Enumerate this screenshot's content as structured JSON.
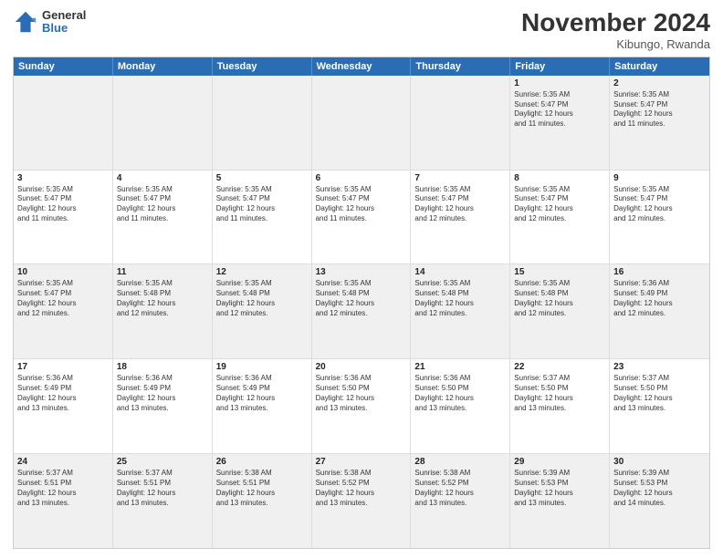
{
  "logo": {
    "general": "General",
    "blue": "Blue"
  },
  "header": {
    "month": "November 2024",
    "location": "Kibungo, Rwanda"
  },
  "weekdays": [
    "Sunday",
    "Monday",
    "Tuesday",
    "Wednesday",
    "Thursday",
    "Friday",
    "Saturday"
  ],
  "rows": [
    {
      "cells": [
        {
          "empty": true
        },
        {
          "empty": true
        },
        {
          "empty": true
        },
        {
          "empty": true
        },
        {
          "empty": true
        },
        {
          "day": 1,
          "lines": [
            "Sunrise: 5:35 AM",
            "Sunset: 5:47 PM",
            "Daylight: 12 hours",
            "and 11 minutes."
          ]
        },
        {
          "day": 2,
          "lines": [
            "Sunrise: 5:35 AM",
            "Sunset: 5:47 PM",
            "Daylight: 12 hours",
            "and 11 minutes."
          ]
        }
      ]
    },
    {
      "cells": [
        {
          "day": 3,
          "lines": [
            "Sunrise: 5:35 AM",
            "Sunset: 5:47 PM",
            "Daylight: 12 hours",
            "and 11 minutes."
          ]
        },
        {
          "day": 4,
          "lines": [
            "Sunrise: 5:35 AM",
            "Sunset: 5:47 PM",
            "Daylight: 12 hours",
            "and 11 minutes."
          ]
        },
        {
          "day": 5,
          "lines": [
            "Sunrise: 5:35 AM",
            "Sunset: 5:47 PM",
            "Daylight: 12 hours",
            "and 11 minutes."
          ]
        },
        {
          "day": 6,
          "lines": [
            "Sunrise: 5:35 AM",
            "Sunset: 5:47 PM",
            "Daylight: 12 hours",
            "and 11 minutes."
          ]
        },
        {
          "day": 7,
          "lines": [
            "Sunrise: 5:35 AM",
            "Sunset: 5:47 PM",
            "Daylight: 12 hours",
            "and 12 minutes."
          ]
        },
        {
          "day": 8,
          "lines": [
            "Sunrise: 5:35 AM",
            "Sunset: 5:47 PM",
            "Daylight: 12 hours",
            "and 12 minutes."
          ]
        },
        {
          "day": 9,
          "lines": [
            "Sunrise: 5:35 AM",
            "Sunset: 5:47 PM",
            "Daylight: 12 hours",
            "and 12 minutes."
          ]
        }
      ]
    },
    {
      "cells": [
        {
          "day": 10,
          "lines": [
            "Sunrise: 5:35 AM",
            "Sunset: 5:47 PM",
            "Daylight: 12 hours",
            "and 12 minutes."
          ]
        },
        {
          "day": 11,
          "lines": [
            "Sunrise: 5:35 AM",
            "Sunset: 5:48 PM",
            "Daylight: 12 hours",
            "and 12 minutes."
          ]
        },
        {
          "day": 12,
          "lines": [
            "Sunrise: 5:35 AM",
            "Sunset: 5:48 PM",
            "Daylight: 12 hours",
            "and 12 minutes."
          ]
        },
        {
          "day": 13,
          "lines": [
            "Sunrise: 5:35 AM",
            "Sunset: 5:48 PM",
            "Daylight: 12 hours",
            "and 12 minutes."
          ]
        },
        {
          "day": 14,
          "lines": [
            "Sunrise: 5:35 AM",
            "Sunset: 5:48 PM",
            "Daylight: 12 hours",
            "and 12 minutes."
          ]
        },
        {
          "day": 15,
          "lines": [
            "Sunrise: 5:35 AM",
            "Sunset: 5:48 PM",
            "Daylight: 12 hours",
            "and 12 minutes."
          ]
        },
        {
          "day": 16,
          "lines": [
            "Sunrise: 5:36 AM",
            "Sunset: 5:49 PM",
            "Daylight: 12 hours",
            "and 12 minutes."
          ]
        }
      ]
    },
    {
      "cells": [
        {
          "day": 17,
          "lines": [
            "Sunrise: 5:36 AM",
            "Sunset: 5:49 PM",
            "Daylight: 12 hours",
            "and 13 minutes."
          ]
        },
        {
          "day": 18,
          "lines": [
            "Sunrise: 5:36 AM",
            "Sunset: 5:49 PM",
            "Daylight: 12 hours",
            "and 13 minutes."
          ]
        },
        {
          "day": 19,
          "lines": [
            "Sunrise: 5:36 AM",
            "Sunset: 5:49 PM",
            "Daylight: 12 hours",
            "and 13 minutes."
          ]
        },
        {
          "day": 20,
          "lines": [
            "Sunrise: 5:36 AM",
            "Sunset: 5:50 PM",
            "Daylight: 12 hours",
            "and 13 minutes."
          ]
        },
        {
          "day": 21,
          "lines": [
            "Sunrise: 5:36 AM",
            "Sunset: 5:50 PM",
            "Daylight: 12 hours",
            "and 13 minutes."
          ]
        },
        {
          "day": 22,
          "lines": [
            "Sunrise: 5:37 AM",
            "Sunset: 5:50 PM",
            "Daylight: 12 hours",
            "and 13 minutes."
          ]
        },
        {
          "day": 23,
          "lines": [
            "Sunrise: 5:37 AM",
            "Sunset: 5:50 PM",
            "Daylight: 12 hours",
            "and 13 minutes."
          ]
        }
      ]
    },
    {
      "cells": [
        {
          "day": 24,
          "lines": [
            "Sunrise: 5:37 AM",
            "Sunset: 5:51 PM",
            "Daylight: 12 hours",
            "and 13 minutes."
          ]
        },
        {
          "day": 25,
          "lines": [
            "Sunrise: 5:37 AM",
            "Sunset: 5:51 PM",
            "Daylight: 12 hours",
            "and 13 minutes."
          ]
        },
        {
          "day": 26,
          "lines": [
            "Sunrise: 5:38 AM",
            "Sunset: 5:51 PM",
            "Daylight: 12 hours",
            "and 13 minutes."
          ]
        },
        {
          "day": 27,
          "lines": [
            "Sunrise: 5:38 AM",
            "Sunset: 5:52 PM",
            "Daylight: 12 hours",
            "and 13 minutes."
          ]
        },
        {
          "day": 28,
          "lines": [
            "Sunrise: 5:38 AM",
            "Sunset: 5:52 PM",
            "Daylight: 12 hours",
            "and 13 minutes."
          ]
        },
        {
          "day": 29,
          "lines": [
            "Sunrise: 5:39 AM",
            "Sunset: 5:53 PM",
            "Daylight: 12 hours",
            "and 13 minutes."
          ]
        },
        {
          "day": 30,
          "lines": [
            "Sunrise: 5:39 AM",
            "Sunset: 5:53 PM",
            "Daylight: 12 hours",
            "and 14 minutes."
          ]
        }
      ]
    }
  ]
}
